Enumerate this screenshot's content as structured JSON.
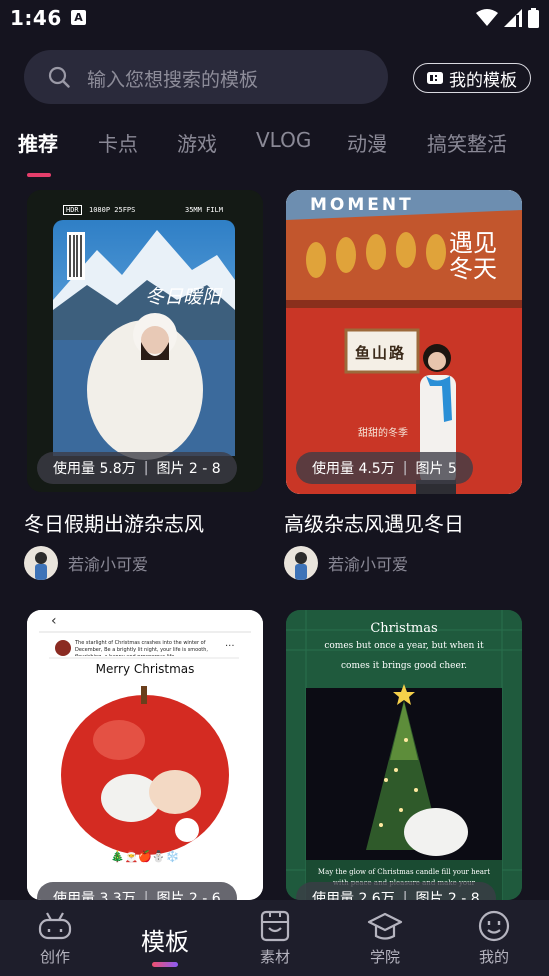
{
  "status": {
    "time": "1:46",
    "notif": "A"
  },
  "search": {
    "placeholder": "输入您想搜索的模板"
  },
  "header": {
    "my_templates": "我的模板"
  },
  "tabs": [
    "推荐",
    "卡点",
    "游戏",
    "VLOG",
    "动漫",
    "搞笑整活"
  ],
  "active_tab": "推荐",
  "cards": [
    {
      "title": "冬日假期出游杂志风",
      "usage": "使用量 5.8万",
      "pics": "图片 2 - 8",
      "author": "若渝小可爱",
      "art": {
        "hdr": "HDR",
        "fps": "1080P 25FPS",
        "film": "35MM FILM",
        "script": "冬日暖阳"
      }
    },
    {
      "title": "高级杂志风遇见冬日",
      "usage": "使用量 4.5万",
      "pics": "图片 5",
      "author": "若渝小可爱",
      "art": {
        "moment": "MOMENT",
        "heading": "遇见冬天",
        "sign": "鱼山路",
        "caption": "甜甜的冬季"
      }
    },
    {
      "usage": "使用量 3.3万",
      "pics": "图片 2 - 6",
      "art": {
        "post_text": "The starlight of Christmas crashes into the winter of December, Be a brightly lit night, your life is smooth, flourishing, a happy and prosperous life",
        "heading": "Merry Christmas",
        "emojis": "🎄🎅🍎⛄❄️"
      }
    },
    {
      "usage": "使用量 2.6万",
      "pics": "图片 2 - 8",
      "art": {
        "line1": "Christmas",
        "line2": "comes but once a year, but when it",
        "line3": "comes it brings good cheer.",
        "footer1": "May the glow of Christmas candle fill your heart",
        "footer2": "with peace and pleasure and make your"
      }
    }
  ],
  "nav": [
    {
      "label": "创作",
      "icon": "create-icon",
      "active": false
    },
    {
      "label": "模板",
      "icon": "template-icon",
      "active": true
    },
    {
      "label": "素材",
      "icon": "material-icon",
      "active": false
    },
    {
      "label": "学院",
      "icon": "academy-icon",
      "active": false
    },
    {
      "label": "我的",
      "icon": "profile-icon",
      "active": false
    }
  ]
}
